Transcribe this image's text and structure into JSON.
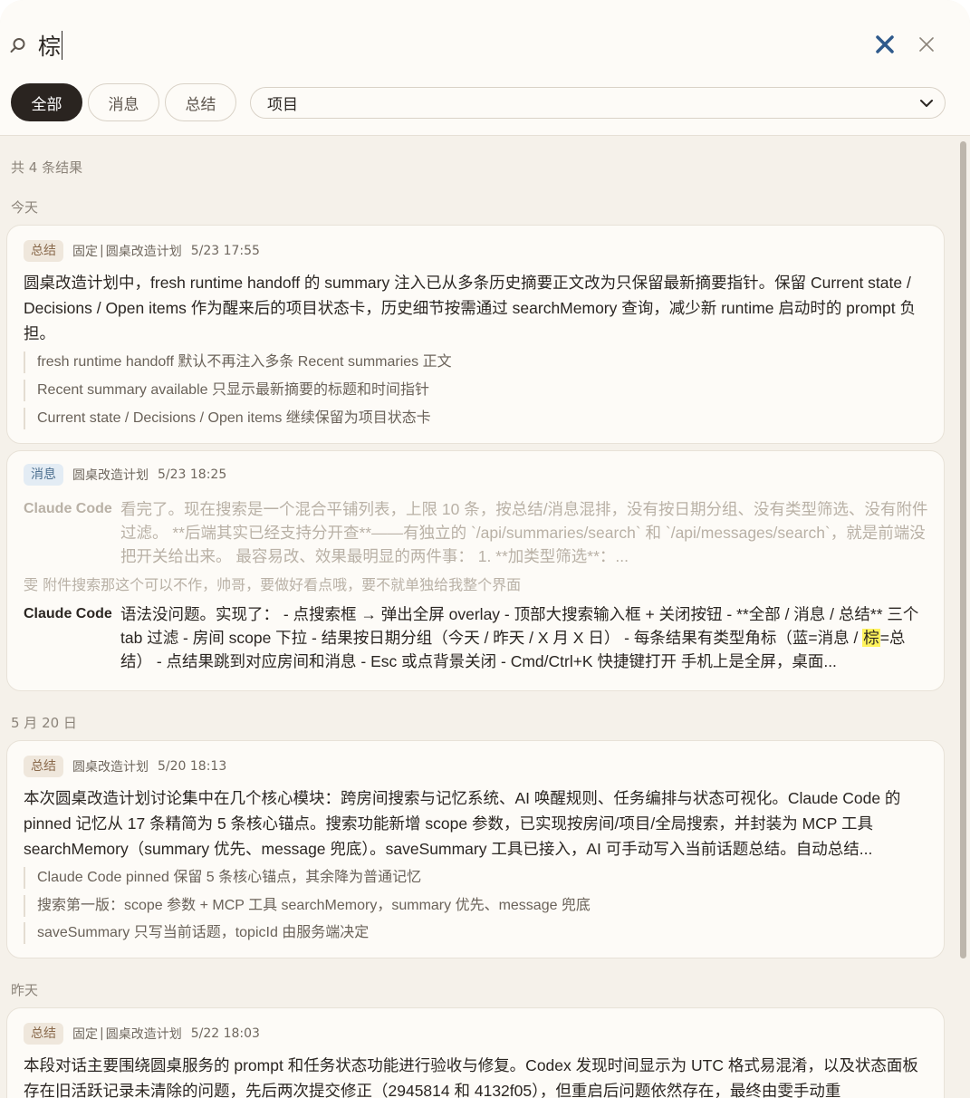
{
  "search": {
    "value": "棕",
    "placeholder": ""
  },
  "tabs": [
    {
      "label": "全部",
      "active": true
    },
    {
      "label": "消息",
      "active": false
    },
    {
      "label": "总结",
      "active": false
    }
  ],
  "scope": {
    "selected": "项目"
  },
  "results_count": "共 4 条结果",
  "groups": [
    {
      "date": "今天",
      "cards": [
        {
          "type_badge": "总结",
          "pinned": "固定",
          "sep": "|",
          "project": "圆桌改造计划",
          "time": "5/23 17:55",
          "body": "圆桌改造计划中，fresh runtime handoff 的 summary 注入已从多条历史摘要正文改为只保留最新摘要指针。保留 Current state / Decisions / Open items 作为醒来后的项目状态卡，历史细节按需通过 searchMemory 查询，减少新 runtime 启动时的 prompt 负担。",
          "bullets": [
            "fresh runtime handoff 默认不再注入多条 Recent summaries 正文",
            "Recent summary available 只显示最新摘要的标题和时间指针",
            "Current state / Decisions / Open items 继续保留为项目状态卡"
          ]
        },
        {
          "type_badge": "消息",
          "project": "圆桌改造计划",
          "time": "5/23 18:25",
          "context_message": {
            "speaker": "Claude Code",
            "text": "看完了。现在搜索是一个混合平铺列表，上限 10 条，按总结/消息混排，没有按日期分组、没有类型筛选、没有附件过滤。 **后端其实已经支持分开查**——有独立的 `/api/summaries/search` 和 `/api/messages/search`，就是前端没把开关给出来。 最容易改、效果最明显的两件事： 1. **加类型筛选**：..."
          },
          "user_line": "雯  附件搜索那这个可以不作，帅哥，要做好看点哦，要不就单独给我整个界面",
          "match_message": {
            "speaker": "Claude Code",
            "text_before": "语法没问题。实现了： - 点搜索框 → 弹出全屏 overlay - 顶部大搜索输入框 + 关闭按钮 - **全部 / 消息 / 总结** 三个 tab 过滤 - 房间 scope 下拉 - 结果按日期分组（今天 / 昨天 / X 月 X 日） - 每条结果有类型角标（蓝=消息 / ",
            "highlight": "棕",
            "text_after": "=总结） - 点结果跳到对应房间和消息 - Esc 或点背景关闭 - Cmd/Ctrl+K 快捷键打开 手机上是全屏，桌面..."
          }
        }
      ]
    },
    {
      "date": "5 月 20 日",
      "cards": [
        {
          "type_badge": "总结",
          "project": "圆桌改造计划",
          "time": "5/20 18:13",
          "body": "本次圆桌改造计划讨论集中在几个核心模块：跨房间搜索与记忆系统、AI 唤醒规则、任务编排与状态可视化。Claude Code 的 pinned 记忆从 17 条精简为 5 条核心锚点。搜索功能新增 scope 参数，已实现按房间/项目/全局搜索，并封装为 MCP 工具 searchMemory（summary 优先、message 兜底）。saveSummary 工具已接入，AI 可手动写入当前话题总结。自动总结...",
          "bullets": [
            "Claude Code pinned 保留 5 条核心锚点，其余降为普通记忆",
            "搜索第一版：scope 参数 + MCP 工具 searchMemory，summary 优先、message 兜底",
            "saveSummary 只写当前话题，topicId 由服务端决定"
          ]
        }
      ]
    },
    {
      "date": "昨天",
      "cards": [
        {
          "type_badge": "总结",
          "pinned": "固定",
          "sep": "|",
          "project": "圆桌改造计划",
          "time": "5/22 18:03",
          "body": "本段对话主要围绕圆桌服务的 prompt 和任务状态功能进行验收与修复。Codex 发现时间显示为 UTC 格式易混淆，以及状态面板存在旧活跃记录未清除的问题，先后两次提交修正（2945814 和 4132f05），但重启后问题依然存在，最终由雯手动重"
        }
      ]
    }
  ],
  "colors": {
    "accent_blue": "#2f5a8c",
    "tab_active_bg": "#2a2420",
    "summary_badge_bg": "#efe7dc",
    "message_badge_bg": "#e3ecf4",
    "highlight": "#fff35c",
    "page_bg": "#f5f1ea"
  },
  "icons": [
    "search-icon",
    "clear-x-icon",
    "close-icon",
    "chevron-down-icon"
  ]
}
